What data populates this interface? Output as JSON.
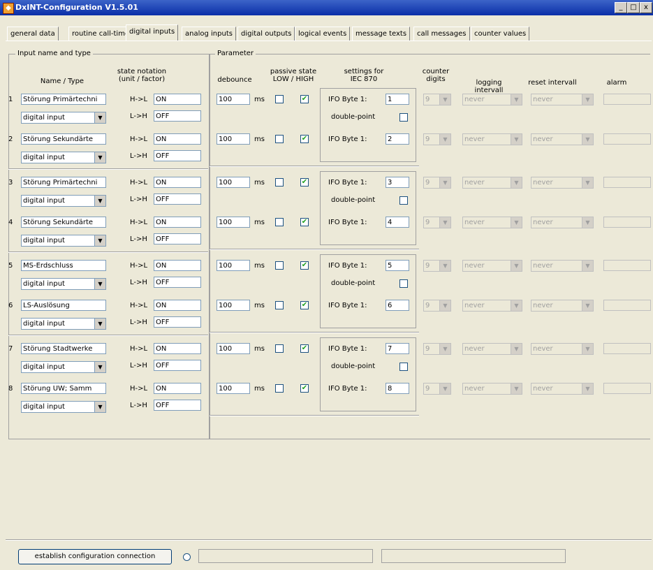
{
  "window": {
    "title": "DxINT-Configuration V1.5.01",
    "minimize": "_",
    "restore": "□",
    "close": "x"
  },
  "tabs": [
    "general data",
    "routine call-timer",
    "digital inputs",
    "analog inputs",
    "digital outputs",
    "logical events",
    "message texts",
    "call messages",
    "counter values"
  ],
  "active_tab": "digital inputs",
  "groups": {
    "input": "Input name and type",
    "parameter": "Parameter"
  },
  "headers": {
    "name_type": "Name / Type",
    "state_notation": "state notation\n(unit / factor)",
    "debounce": "debounce",
    "passive_state": "passive state\nLOW / HIGH",
    "settings_iec": "settings for\nIEC 870",
    "counter_digits": "counter digits",
    "logging_interval": "logging intervall",
    "reset_interval": "reset intervall",
    "alarm": "alarm"
  },
  "labels": {
    "hl": "H->L",
    "lh": "L->H",
    "ms": "ms",
    "ifo": "IFO Byte 1:",
    "double_point": "double-point"
  },
  "rows": [
    {
      "num": "1",
      "name": "Störung Primärtechni",
      "type": "digital input",
      "hl": "ON",
      "lh": "OFF",
      "debounce": "100",
      "low": false,
      "high": true,
      "ifo": "1",
      "digits": "9",
      "logging": "never",
      "reset": "never"
    },
    {
      "num": "2",
      "name": "Störung Sekundärte",
      "type": "digital input",
      "hl": "ON",
      "lh": "OFF",
      "debounce": "100",
      "low": false,
      "high": true,
      "ifo": "2",
      "digits": "9",
      "logging": "never",
      "reset": "never"
    },
    {
      "num": "3",
      "name": "Störung Primärtechni",
      "type": "digital input",
      "hl": "ON",
      "lh": "OFF",
      "debounce": "100",
      "low": false,
      "high": true,
      "ifo": "3",
      "digits": "9",
      "logging": "never",
      "reset": "never"
    },
    {
      "num": "4",
      "name": "Störung Sekundärte",
      "type": "digital input",
      "hl": "ON",
      "lh": "OFF",
      "debounce": "100",
      "low": false,
      "high": true,
      "ifo": "4",
      "digits": "9",
      "logging": "never",
      "reset": "never"
    },
    {
      "num": "5",
      "name": "MS-Erdschluss",
      "type": "digital input",
      "hl": "ON",
      "lh": "OFF",
      "debounce": "100",
      "low": false,
      "high": true,
      "ifo": "5",
      "digits": "9",
      "logging": "never",
      "reset": "never"
    },
    {
      "num": "6",
      "name": "LS-Auslösung",
      "type": "digital input",
      "hl": "ON",
      "lh": "OFF",
      "debounce": "100",
      "low": false,
      "high": true,
      "ifo": "6",
      "digits": "9",
      "logging": "never",
      "reset": "never"
    },
    {
      "num": "7",
      "name": "Störung Stadtwerke",
      "type": "digital input",
      "hl": "ON",
      "lh": "OFF",
      "debounce": "100",
      "low": false,
      "high": true,
      "ifo": "7",
      "digits": "9",
      "logging": "never",
      "reset": "never"
    },
    {
      "num": "8",
      "name": "Störung UW; Samm",
      "type": "digital input",
      "hl": "ON",
      "lh": "OFF",
      "debounce": "100",
      "low": false,
      "high": true,
      "ifo": "8",
      "digits": "9",
      "logging": "never",
      "reset": "never"
    }
  ],
  "footer": {
    "connect_button": "establish configuration connection"
  }
}
